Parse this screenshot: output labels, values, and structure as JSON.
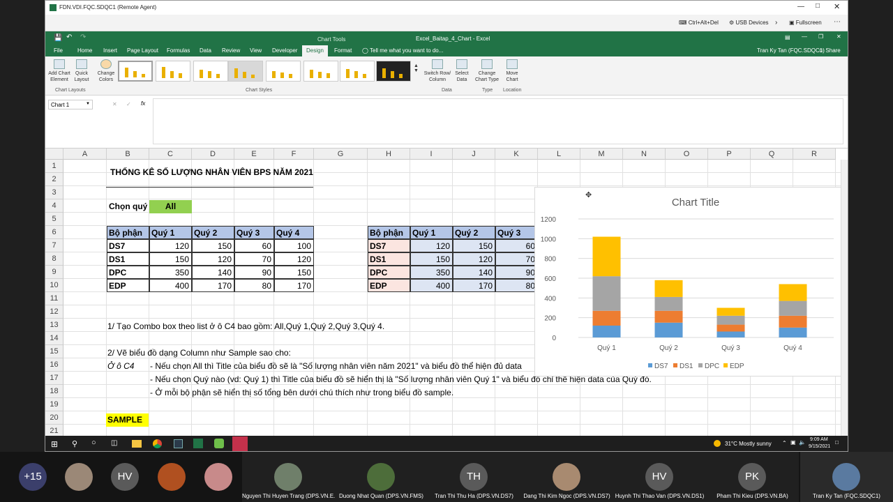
{
  "rdp": {
    "title": "FDN.VDI.FQC.SDQC1 (Remote Agent)",
    "ctrl_alt_del": "Ctrl+Alt+Del",
    "usb": "USB Devices",
    "fullscreen": "Fullscreen"
  },
  "excel": {
    "chart_tools": "Chart Tools",
    "file_title": "Excel_Baitap_4_Chart - Excel",
    "user": "Tran Ky Tan (FQC.SDQC1)",
    "share": "Share",
    "tell_me": "Tell me what you want to do...",
    "tabs": [
      "File",
      "Home",
      "Insert",
      "Page Layout",
      "Formulas",
      "Data",
      "Review",
      "View",
      "Developer",
      "Design",
      "Format"
    ],
    "ribbon": {
      "add_chart_element": "Add Chart Element",
      "quick_layout": "Quick Layout",
      "chart_layouts": "Chart Layouts",
      "change_colors": "Change Colors",
      "chart_styles": "Chart Styles",
      "switch_row_col": "Switch Row/ Column",
      "select_data": "Select Data",
      "data_group": "Data",
      "change_chart_type": "Change Chart Type",
      "type_group": "Type",
      "move_chart": "Move Chart",
      "location_group": "Location"
    },
    "name_box": "Chart 1",
    "fx": "fx"
  },
  "sheet": {
    "columns": [
      "A",
      "B",
      "C",
      "D",
      "E",
      "F",
      "G",
      "H",
      "I",
      "J",
      "K",
      "L",
      "M",
      "N",
      "O",
      "P",
      "Q",
      "R"
    ],
    "rows": [
      "1",
      "2",
      "3",
      "4",
      "5",
      "6",
      "7",
      "8",
      "9",
      "10",
      "11",
      "12",
      "13",
      "14",
      "15",
      "16",
      "17",
      "18",
      "19",
      "20",
      "21"
    ],
    "title": "THỐNG KÊ SỐ LƯỢNG NHÂN VIÊN BPS NĂM 2021",
    "chon_quy": "Chọn quý",
    "chon_quy_value": "All",
    "table_headers": [
      "Bộ phận",
      "Quý 1",
      "Quý 2",
      "Quý 3",
      "Quý 4"
    ],
    "table_rows": [
      [
        "DS7",
        "120",
        "150",
        "60",
        "100"
      ],
      [
        "DS1",
        "150",
        "120",
        "70",
        "120"
      ],
      [
        "DPC",
        "350",
        "140",
        "90",
        "150"
      ],
      [
        "EDP",
        "400",
        "170",
        "80",
        "170"
      ]
    ],
    "table2_headers": [
      "Bộ phận",
      "Quý 1",
      "Quý 2",
      "Quý 3"
    ],
    "table2_rows": [
      [
        "DS7",
        "120",
        "150",
        "60"
      ],
      [
        "DS1",
        "150",
        "120",
        "70"
      ],
      [
        "DPC",
        "350",
        "140",
        "90"
      ],
      [
        "EDP",
        "400",
        "170",
        "80"
      ]
    ],
    "line13": "1/ Tạo Combo box theo list ở ô C4 bao gồm: All,Quý 1,Quý 2,Quý 3,Quý 4.",
    "line15": "2/ Vẽ biểu đồ dạng Column như Sample sao cho:",
    "line16_label": "Ở ô C4",
    "line16": "- Nếu chọn All thì Title của biểu đồ sẽ là \"Số lượng nhân viên năm 2021\" và biểu đồ thể hiện đủ data",
    "line17": "- Nếu chọn Quý nào (vd: Quý 1) thì Title của biểu đồ sẽ hiển thị là \"Số lượng nhân viên Quý 1\" và biểu đồ chỉ thể hiện data của Quý đó.",
    "line18": "- Ở mỗi bộ phận sẽ hiển thị số tổng bên dưới chú thích như trong biểu đồ sample.",
    "sample": "SAMPLE"
  },
  "chart_data": {
    "type": "bar",
    "stacked": true,
    "title": "Chart Title",
    "categories": [
      "Quý 1",
      "Quý 2",
      "Quý 3",
      "Quý 4"
    ],
    "series": [
      {
        "name": "DS7",
        "values": [
          120,
          150,
          60,
          100
        ],
        "color": "#5b9bd5"
      },
      {
        "name": "DS1",
        "values": [
          150,
          120,
          70,
          120
        ],
        "color": "#ed7d31"
      },
      {
        "name": "DPC",
        "values": [
          350,
          140,
          90,
          150
        ],
        "color": "#a5a5a5"
      },
      {
        "name": "EDP",
        "values": [
          400,
          170,
          80,
          170
        ],
        "color": "#ffc000"
      }
    ],
    "ylim": [
      0,
      1200
    ],
    "yticks": [
      "0",
      "200",
      "400",
      "600",
      "800",
      "1000",
      "1200"
    ],
    "legend": "bottom",
    "grid": true
  },
  "taskbar": {
    "weather": "31°C  Mostly sunny",
    "time": "9:09 AM",
    "date": "9/15/2021"
  },
  "meeting": {
    "more": "+15",
    "initials": [
      "HV"
    ],
    "participants": [
      {
        "name": "Nguyen Thi Huyen Trang (DPS.VN.E...",
        "initials": ""
      },
      {
        "name": "Duong Nhat Quan (DPS.VN.FMS)",
        "initials": ""
      },
      {
        "name": "Tran Thi Thu Ha (DPS.VN.DS7)",
        "initials": "TH"
      },
      {
        "name": "Dang Thi Kim Ngoc (DPS.VN.DS7)",
        "initials": ""
      },
      {
        "name": "Huynh Thi Thao Van (DPS.VN.DS1)",
        "initials": "HV"
      },
      {
        "name": "Pham Thi Kieu (DPS.VN.BA)",
        "initials": "PK"
      },
      {
        "name": "Tran Ky Tan (FQC.SDQC1)",
        "initials": ""
      }
    ]
  }
}
